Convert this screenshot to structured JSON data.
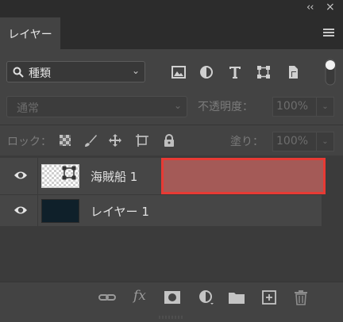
{
  "panel": {
    "tab_label": "レイヤー",
    "collapse_glyph": "‹‹",
    "close_glyph": "×"
  },
  "filter": {
    "label": "種類",
    "icons": [
      "image-filter-icon",
      "adjustment-filter-icon",
      "type-filter-icon",
      "shape-filter-icon",
      "smart-object-filter-icon"
    ]
  },
  "blend": {
    "mode": "通常",
    "opacity_label": "不透明度：",
    "opacity_value": "100%"
  },
  "lock": {
    "label": "ロック：",
    "fill_label": "塗り：",
    "fill_value": "100%"
  },
  "layers": [
    {
      "name": "海賊船 1",
      "visible": true,
      "thumbnail": "transparent",
      "has_vector_mask": true
    },
    {
      "name": "レイヤー 1",
      "visible": true,
      "thumbnail": "#0f202a",
      "has_vector_mask": false
    }
  ],
  "highlight": {
    "color": "#e83a34",
    "fill": "#a45a57"
  },
  "footer": {
    "fx_label": "fx",
    "icons": [
      "link-layers-icon",
      "fx-icon",
      "add-mask-icon",
      "adjustment-layer-icon",
      "new-group-icon",
      "new-layer-icon",
      "delete-layer-icon"
    ]
  }
}
